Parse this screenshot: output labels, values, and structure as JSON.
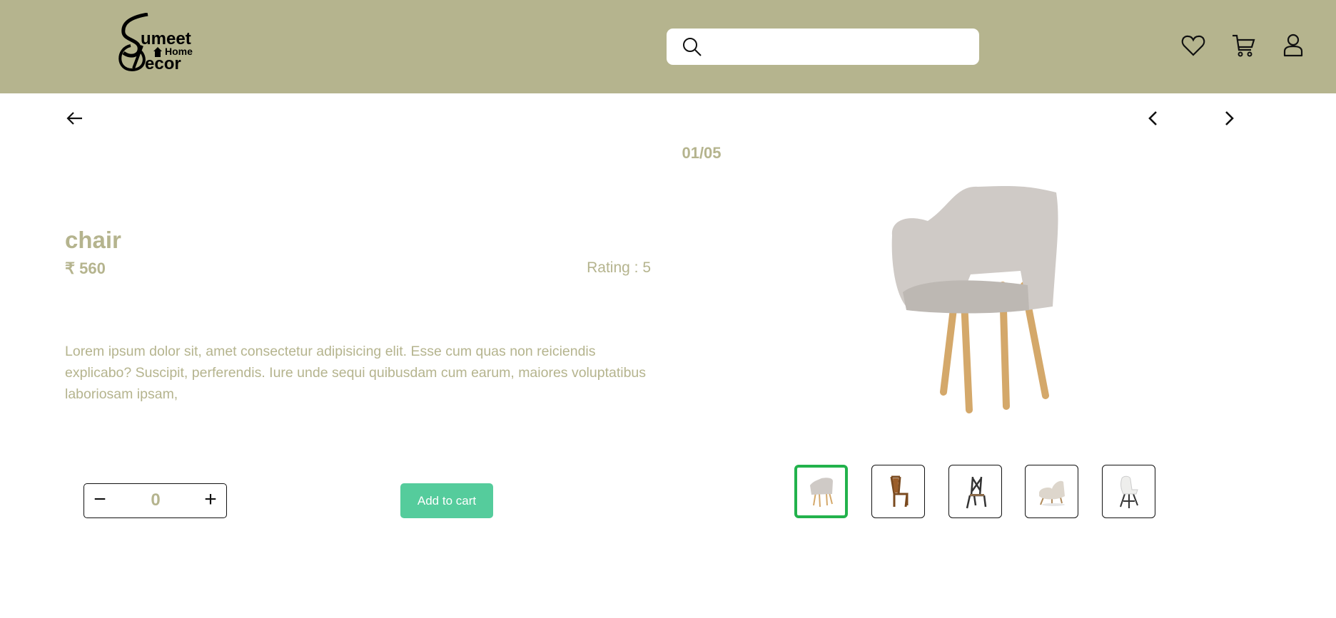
{
  "header": {
    "logo_text": "Sumeet Home Decor",
    "search": {
      "value": "",
      "placeholder": ""
    },
    "icons": [
      "heart-icon",
      "cart-icon",
      "user-icon"
    ]
  },
  "nav": {
    "counter": "01/05"
  },
  "product": {
    "title": "chair",
    "price": "₹ 560",
    "rating": "Rating : 5",
    "description": "Lorem ipsum dolor sit, amet consectetur adipisicing elit. Esse cum quas non reiciendis explicabo? Suscipit, perferendis. Iure unde sequi quibusdam cum earum, maiores voluptatibus laboriosam ipsam,"
  },
  "cart": {
    "quantity": "0",
    "minus": "−",
    "plus": "+",
    "add_label": "Add to cart"
  },
  "thumbnails": [
    {
      "name": "grey-armchair",
      "active": true
    },
    {
      "name": "wooden-chair"
    },
    {
      "name": "black-cross-back-chair"
    },
    {
      "name": "lounge-chair"
    },
    {
      "name": "white-shell-chair"
    }
  ],
  "colors": {
    "header": "#b5b48e",
    "accent": "#55cc9c",
    "active_thumb": "#22b24c"
  }
}
